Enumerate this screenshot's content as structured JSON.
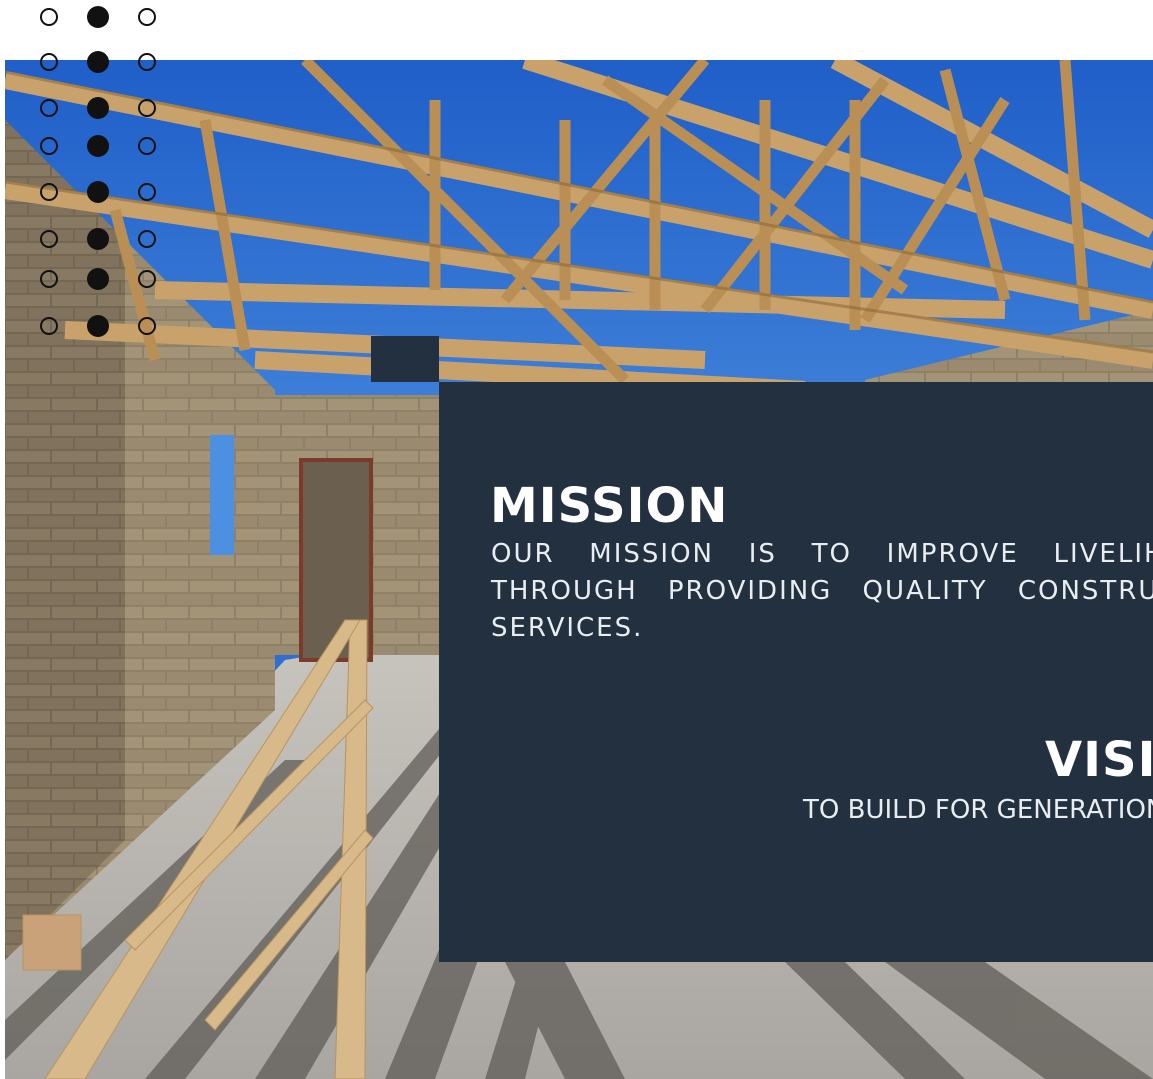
{
  "mission": {
    "title": "MISSION",
    "text": "OUR MISSION IS TO IMPROVE LIVELIHOODS THROUGH PROVIDING QUALITY CONSTRUCTION SERVICES."
  },
  "vision": {
    "title": "VISION",
    "text": "TO BUILD FOR GENERATIONS"
  },
  "photo": {
    "icon": "construction-site-photo"
  },
  "colors": {
    "panel": "#22303f",
    "accent": "#22303f",
    "dots": "#111111",
    "text": "#ffffff",
    "sky": "#2f6fd0"
  }
}
